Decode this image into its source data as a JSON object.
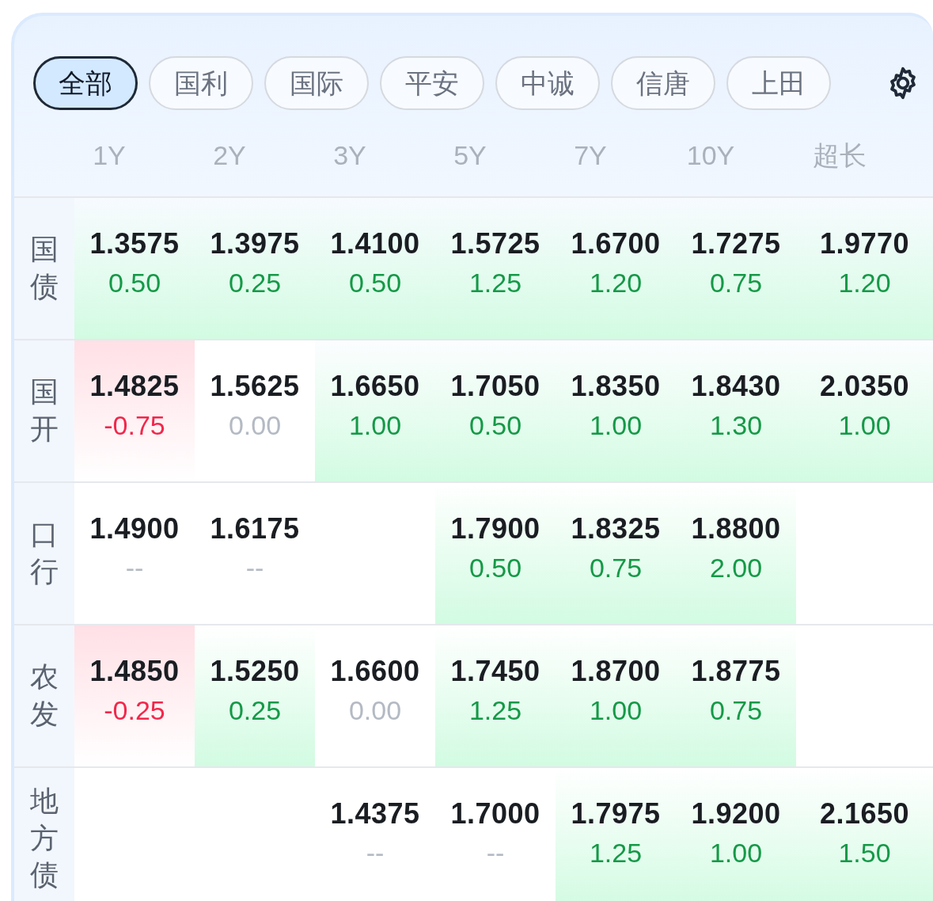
{
  "tabs": [
    {
      "label": "全部",
      "selected": true
    },
    {
      "label": "国利",
      "selected": false
    },
    {
      "label": "国际",
      "selected": false
    },
    {
      "label": "平安",
      "selected": false
    },
    {
      "label": "中诚",
      "selected": false
    },
    {
      "label": "信唐",
      "selected": false
    },
    {
      "label": "上田",
      "selected": false
    }
  ],
  "columns": [
    "1Y",
    "2Y",
    "3Y",
    "5Y",
    "7Y",
    "10Y",
    "超长"
  ],
  "rows": [
    {
      "label": "国债",
      "cells": [
        {
          "value": "1.3575",
          "change": "0.50",
          "kind": "up"
        },
        {
          "value": "1.3975",
          "change": "0.25",
          "kind": "up"
        },
        {
          "value": "1.4100",
          "change": "0.50",
          "kind": "up"
        },
        {
          "value": "1.5725",
          "change": "1.25",
          "kind": "up"
        },
        {
          "value": "1.6700",
          "change": "1.20",
          "kind": "up"
        },
        {
          "value": "1.7275",
          "change": "0.75",
          "kind": "up"
        },
        {
          "value": "1.9770",
          "change": "1.20",
          "kind": "up"
        }
      ]
    },
    {
      "label": "国开",
      "cells": [
        {
          "value": "1.4825",
          "change": "-0.75",
          "kind": "down"
        },
        {
          "value": "1.5625",
          "change": "0.00",
          "kind": "flat"
        },
        {
          "value": "1.6650",
          "change": "1.00",
          "kind": "up"
        },
        {
          "value": "1.7050",
          "change": "0.50",
          "kind": "up"
        },
        {
          "value": "1.8350",
          "change": "1.00",
          "kind": "up"
        },
        {
          "value": "1.8430",
          "change": "1.30",
          "kind": "up"
        },
        {
          "value": "2.0350",
          "change": "1.00",
          "kind": "up"
        }
      ]
    },
    {
      "label": "口行",
      "cells": [
        {
          "value": "1.4900",
          "change": "--",
          "kind": "flat"
        },
        {
          "value": "1.6175",
          "change": "--",
          "kind": "flat"
        },
        null,
        {
          "value": "1.7900",
          "change": "0.50",
          "kind": "up"
        },
        {
          "value": "1.8325",
          "change": "0.75",
          "kind": "up"
        },
        {
          "value": "1.8800",
          "change": "2.00",
          "kind": "up"
        },
        null
      ]
    },
    {
      "label": "农发",
      "cells": [
        {
          "value": "1.4850",
          "change": "-0.25",
          "kind": "down"
        },
        {
          "value": "1.5250",
          "change": "0.25",
          "kind": "up"
        },
        {
          "value": "1.6600",
          "change": "0.00",
          "kind": "flat"
        },
        {
          "value": "1.7450",
          "change": "1.25",
          "kind": "up"
        },
        {
          "value": "1.8700",
          "change": "1.00",
          "kind": "up"
        },
        {
          "value": "1.8775",
          "change": "0.75",
          "kind": "up"
        },
        null
      ]
    },
    {
      "label": "地方债",
      "cells": [
        null,
        null,
        {
          "value": "1.4375",
          "change": "--",
          "kind": "flat"
        },
        {
          "value": "1.7000",
          "change": "--",
          "kind": "flat"
        },
        {
          "value": "1.7975",
          "change": "1.25",
          "kind": "up"
        },
        {
          "value": "1.9200",
          "change": "1.00",
          "kind": "up"
        },
        {
          "value": "2.1650",
          "change": "1.50",
          "kind": "up"
        }
      ]
    }
  ]
}
